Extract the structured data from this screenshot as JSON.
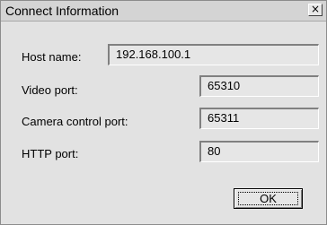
{
  "window": {
    "title": "Connect Information",
    "close_icon": "×"
  },
  "fields": {
    "host": {
      "label": "Host name:",
      "value": "192.168.100.1"
    },
    "video_port": {
      "label": "Video port:",
      "value": "65310"
    },
    "camera_control_port": {
      "label": "Camera control port:",
      "value": "65311"
    },
    "http_port": {
      "label": "HTTP port:",
      "value": "80"
    }
  },
  "buttons": {
    "ok_label": "OK"
  }
}
